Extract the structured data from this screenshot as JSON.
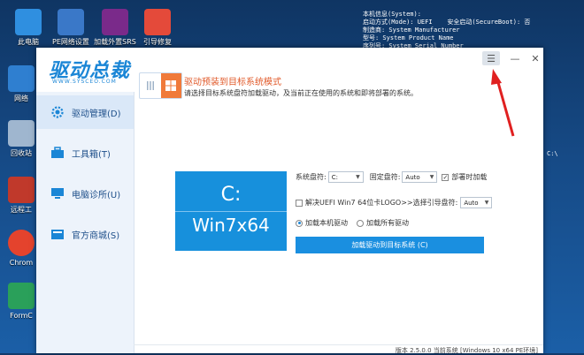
{
  "desktop": {
    "icons": [
      {
        "label": "此电脑"
      },
      {
        "label": "PE网络设置"
      },
      {
        "label": "加载外置SRS"
      },
      {
        "label": "引导修复"
      },
      {
        "label": "网络"
      },
      {
        "label": "回收站"
      },
      {
        "label": "远程工"
      },
      {
        "label": "Chrom"
      },
      {
        "label": "FormC"
      }
    ],
    "sysinfo": [
      "本机信息(System):",
      "启动方式(Mode): UEFI    安全启动(SecureBoot): 否",
      "制造商: System Manufacturer",
      "型号: System Product Name",
      "序列号: System Serial Number"
    ],
    "right_label": "C:\\"
  },
  "app": {
    "logo": {
      "text": "驱动总裁",
      "sub": "WWW.SYSCEO.COM"
    },
    "nav": [
      {
        "label": "驱动管理(D)"
      },
      {
        "label": "工具箱(T)"
      },
      {
        "label": "电脑诊所(U)"
      },
      {
        "label": "官方商城(S)"
      }
    ],
    "window_buttons": {
      "menu": "☰",
      "minimize": "—",
      "close": "✕"
    },
    "mode": {
      "title": "驱动预装到目标系统模式",
      "desc": "请选择目标系统盘符加载驱动，及当前正在使用的系统和即将部署的系统。"
    },
    "os_tile": {
      "drive": "C:",
      "os": "Win7x64"
    },
    "form": {
      "system_drive_label": "系统盘符:",
      "system_drive_value": "C:",
      "fixed_drive_label": "固定盘符:",
      "fixed_drive_value": "Auto",
      "deploy_load_label": "部署时加载",
      "uefi_label": "解决UEFI Win7 64位卡LOGO>>选择引导盘符:",
      "uefi_value": "Auto",
      "radio_local": "加载本机驱动",
      "radio_all": "加载所有驱动",
      "load_button": "加载驱动到目标系统 (C)"
    },
    "status": "版本 2.5.0.0  当前系统 [Windows 10 x64 PE环境]",
    "colors": {
      "accent": "#1a8fe0",
      "title_orange": "#e15a2a",
      "arrow": "#e02020"
    }
  }
}
